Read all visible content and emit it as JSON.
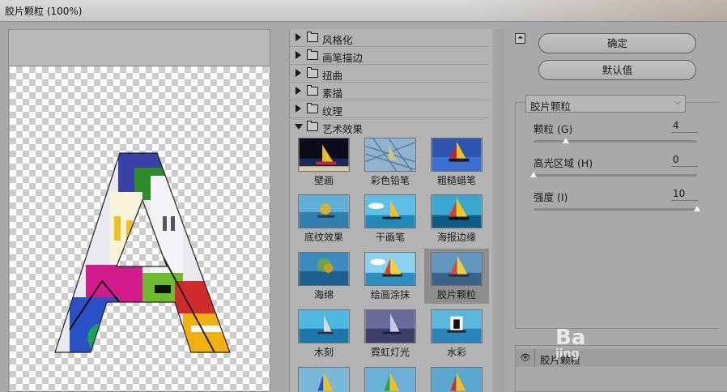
{
  "window": {
    "title": "胶片颗粒 (100%)"
  },
  "categories": [
    {
      "label": "风格化",
      "expanded": false
    },
    {
      "label": "画笔描边",
      "expanded": false
    },
    {
      "label": "扭曲",
      "expanded": false
    },
    {
      "label": "素描",
      "expanded": false
    },
    {
      "label": "纹理",
      "expanded": false
    },
    {
      "label": "艺术效果",
      "expanded": true
    }
  ],
  "filters": [
    {
      "label": "壁画",
      "icon": "fresco-thumb"
    },
    {
      "label": "彩色铅笔",
      "icon": "colored-pencil-thumb"
    },
    {
      "label": "粗糙蜡笔",
      "icon": "rough-pastels-thumb"
    },
    {
      "label": "底纹效果",
      "icon": "underpainting-thumb"
    },
    {
      "label": "干画笔",
      "icon": "dry-brush-thumb"
    },
    {
      "label": "海报边缘",
      "icon": "poster-edges-thumb"
    },
    {
      "label": "海绵",
      "icon": "sponge-thumb"
    },
    {
      "label": "绘画涂抹",
      "icon": "paint-daubs-thumb"
    },
    {
      "label": "胶片颗粒",
      "icon": "film-grain-thumb",
      "selected": true
    },
    {
      "label": "木刻",
      "icon": "cutout-thumb"
    },
    {
      "label": "霓虹灯光",
      "icon": "neon-glow-thumb"
    },
    {
      "label": "水彩",
      "icon": "watercolor-thumb"
    }
  ],
  "buttons": {
    "ok": "确定",
    "default": "默认值"
  },
  "filter_select": {
    "value": "胶片颗粒"
  },
  "params": [
    {
      "label": "颗粒 (G)",
      "value": "4",
      "fraction": 0.2
    },
    {
      "label": "高光区域 (H)",
      "value": "0",
      "fraction": 0.0
    },
    {
      "label": "强度 (I)",
      "value": "10",
      "fraction": 1.0
    }
  ],
  "layers": [
    {
      "label": "胶片颗粒",
      "visible": true
    }
  ],
  "watermark": {
    "big": "Ba",
    "small": "jing"
  },
  "colors": {
    "panel": "#b3b3b3",
    "selected": "#8e8e8e",
    "knob": "#f2f2f2"
  }
}
